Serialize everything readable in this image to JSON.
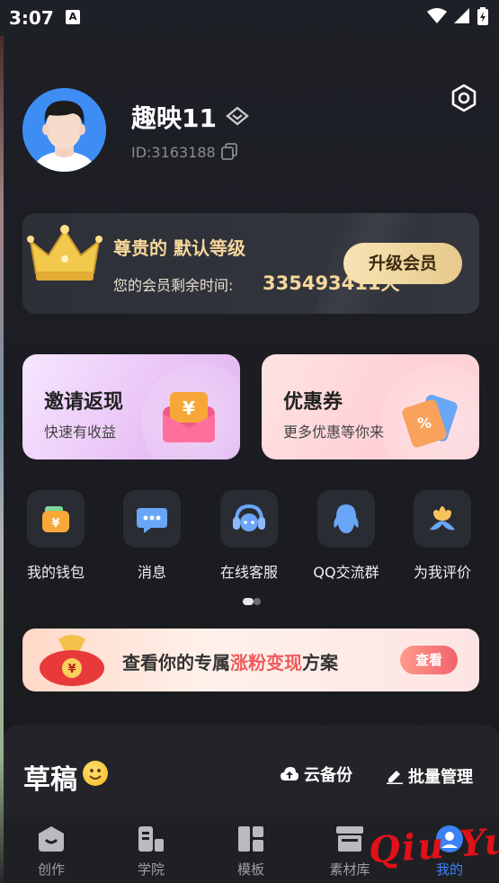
{
  "status_bar": {
    "time": "3:07",
    "notif_glyph": "A"
  },
  "profile": {
    "name": "趣映11",
    "id_text": "ID:3163188"
  },
  "vip": {
    "title": "尊贵的 默认等级",
    "remaining_label": "您的会员剩余时间:",
    "remaining_value": "335493411天",
    "upgrade_label": "升级会员"
  },
  "promos": [
    {
      "title": "邀请返现",
      "subtitle": "快速有收益",
      "icon": "red-packet-icon"
    },
    {
      "title": "优惠券",
      "subtitle": "更多优惠等你来",
      "icon": "coupon-ticket-icon"
    }
  ],
  "grid": [
    {
      "label": "我的钱包",
      "icon": "wallet-icon"
    },
    {
      "label": "消息",
      "icon": "message-icon"
    },
    {
      "label": "在线客服",
      "icon": "headset-icon"
    },
    {
      "label": "QQ交流群",
      "icon": "qq-penguin-icon"
    },
    {
      "label": "为我评价",
      "icon": "flower-icon"
    }
  ],
  "banner": {
    "text_pre": "查看你的专属",
    "text_highlight": "涨粉变现",
    "text_post": "方案",
    "button_label": "查看",
    "icon": "money-bag-icon"
  },
  "drafts": {
    "title": "草稿",
    "cloud_backup_label": "云备份",
    "batch_manage_label": "批量管理"
  },
  "bottom_nav": [
    {
      "label": "创作",
      "icon": "create-icon"
    },
    {
      "label": "学院",
      "icon": "academy-icon"
    },
    {
      "label": "模板",
      "icon": "template-icon"
    },
    {
      "label": "素材库",
      "icon": "store-icon"
    },
    {
      "label": "我的",
      "icon": "profile-icon",
      "active": true
    }
  ],
  "watermark": "Qiu Yue",
  "colors": {
    "accent_gold": "#f5d79a",
    "active_blue": "#3b82f6",
    "highlight_red": "#f05b5b"
  }
}
